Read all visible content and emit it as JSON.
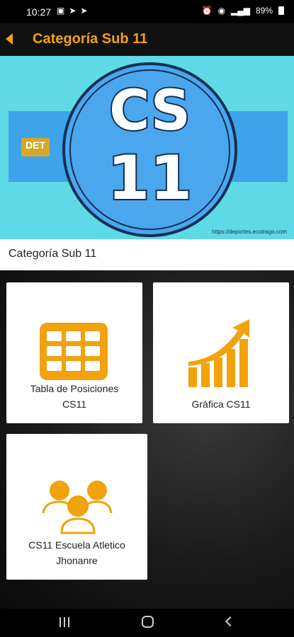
{
  "status_bar": {
    "time": "10:27",
    "battery": "89%"
  },
  "app_bar": {
    "title": "Categoría Sub 11"
  },
  "banner": {
    "logo_text": "DET",
    "badge_line1": "CS",
    "badge_line2": "11",
    "url": "https://deportes.ecotrago.com"
  },
  "section": {
    "title": "Categoría Sub 11"
  },
  "tiles": [
    {
      "label_line1": "Tabla de Posiciones",
      "label_line2": "CS11",
      "icon": "table-grid-icon"
    },
    {
      "label_line1": "Gráfica CS11",
      "label_line2": "",
      "icon": "growth-chart-icon"
    },
    {
      "label_line1": "CS11 Escuela Atletico",
      "label_line2": "Jhonanre",
      "icon": "users-group-icon"
    }
  ],
  "colors": {
    "accent": "#f2a20c",
    "banner_bg": "#5fd9e6",
    "badge_blue": "#4aa7ee",
    "navy": "#123056"
  }
}
